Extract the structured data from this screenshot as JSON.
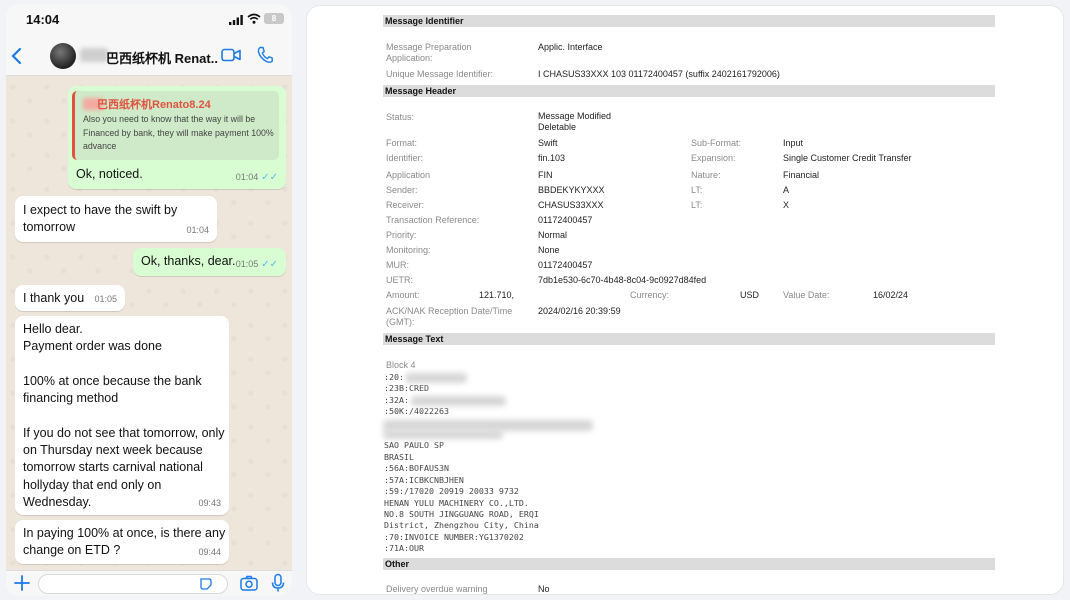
{
  "phone": {
    "time": "14:04",
    "battery": "8",
    "contact_name": "巴西纸杯机 Renat...",
    "icons": [
      "back-icon",
      "video-call-icon",
      "phone-icon",
      "plus-icon",
      "sticker-icon",
      "camera-icon",
      "mic-icon"
    ]
  },
  "messages": [
    {
      "id": "m1",
      "direction": "out",
      "quote_author": "巴西纸杯机Renato8.24",
      "quote_text": "Also you need to know that the way it will be Financed by bank, they will make payment 100% advance",
      "text": "Ok, noticed.",
      "time": "01:04",
      "read": true
    },
    {
      "id": "m2",
      "direction": "in",
      "text": "I expect to have the swift by tomorrow",
      "time": "01:04"
    },
    {
      "id": "m3",
      "direction": "out",
      "text": "Ok, thanks, dear.",
      "time": "01:05",
      "read": true
    },
    {
      "id": "m4",
      "direction": "in",
      "text": "I thank you",
      "time": "01:05"
    },
    {
      "id": "m5",
      "direction": "in",
      "text": "Hello dear.\nPayment order was done\n\n100% at once because the bank financing method\n\nIf you do not see that tomorrow, only on Thursday next week because tomorrow starts carnival  national hollyday that end only on Wednesday.",
      "time": "09:43"
    },
    {
      "id": "m6",
      "direction": "in",
      "text": "In paying 100% at once, is there any change on ETD ?",
      "time": "09:44"
    }
  ],
  "document": {
    "sections": {
      "identifier": "Message Identifier",
      "header": "Message Header",
      "text": "Message Text",
      "other": "Other"
    },
    "identifier": {
      "prep_label": "Message Preparation\nApplication:",
      "prep_value": "Applic. Interface",
      "umi_label": "Unique Message Identifier:",
      "umi_value": "I CHASUS33XXX 103 01172400457 (suffix 2402161792006)"
    },
    "header": {
      "status_label": "Status:",
      "status_value": "Message Modified\nDeletable",
      "format_label": "Format:",
      "format_value": "Swift",
      "subformat_label": "Sub-Format:",
      "subformat_value": "Input",
      "identifier_label": "Identifier:",
      "identifier_value": "fin.103",
      "expansion_label": "Expansion:",
      "expansion_value": "Single Customer Credit Transfer",
      "application_label": "Application",
      "application_value": "FIN",
      "nature_label": "Nature:",
      "nature_value": "Financial",
      "sender_label": "Sender:",
      "sender_value": "BBDEKYKYXXX",
      "lt1_label": "LT:",
      "lt1_value": "A",
      "receiver_label": "Receiver:",
      "receiver_value": "CHASUS33XXX",
      "lt2_label": "LT:",
      "lt2_value": "X",
      "txref_label": "Transaction Reference:",
      "txref_value": "01172400457",
      "priority_label": "Priority:",
      "priority_value": "Normal",
      "monitoring_label": "Monitoring:",
      "monitoring_value": "None",
      "mur_label": "MUR:",
      "mur_value": "01172400457",
      "uetr_label": "UETR:",
      "uetr_value": "7db1e530-6c70-4b48-8c04-9c0927d84fed",
      "amount_label": "Amount:",
      "amount_value": "121.710,",
      "currency_label": "Currency:",
      "currency_value": "USD",
      "valuedate_label": "Value Date:",
      "valuedate_value": "16/02/24",
      "ack_label": "ACK/NAK Reception Date/Time\n(GMT):",
      "ack_value": "2024/02/16 20:39:59"
    },
    "message_text": {
      "block": "Block 4",
      "lines": [
        ":20:",
        ":23B:CRED",
        ":32A:",
        ":50K:/4022263",
        "",
        "SAO PAULO SP",
        "BRASIL",
        ":56A:BOFAUS3N",
        ":57A:ICBKCNBJHEN",
        ":59:/17020 20919 20033 9732",
        "HENAN YULU MACHINERY CO.,LTD.",
        "NO.8 SOUTH JINGGUANG ROAD, ERQI",
        "District, Zhengzhou City, China",
        ":70:INVOICE NUMBER:YG1370202",
        ":71A:OUR"
      ]
    },
    "other": {
      "delivery_label": "Delivery overdue warning",
      "delivery_value": "No"
    }
  }
}
